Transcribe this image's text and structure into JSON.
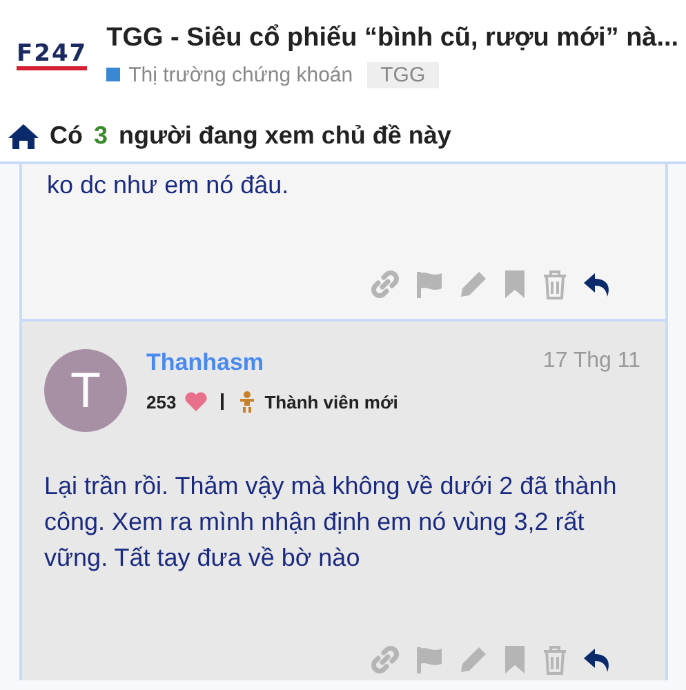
{
  "header": {
    "logo": "F247",
    "title": "TGG - Siêu cổ phiếu “bình cũ, rượu mới” nà...",
    "category": {
      "name": "Thị trường chứng khoán",
      "color": "#3a87d4"
    },
    "tag": "TGG"
  },
  "viewers": {
    "prefix": "Có",
    "count": "3",
    "suffix": "người đang xem chủ đề này"
  },
  "posts": [
    {
      "kind": "fragment",
      "body": "ko dc như em nó đâu."
    },
    {
      "kind": "full",
      "avatar_letter": "T",
      "color": "#a890a4",
      "author": "Thanhasm",
      "date": "17 Thg 11",
      "likes": "253",
      "title_text": "Thành viên mới",
      "body": "Lại trần rồi. Thảm vậy mà không về dưới 2 đã thành công. Xem ra mình nhận định em nó vùng 3,2 rất vững. Tất tay đưa về bờ nào"
    }
  ]
}
